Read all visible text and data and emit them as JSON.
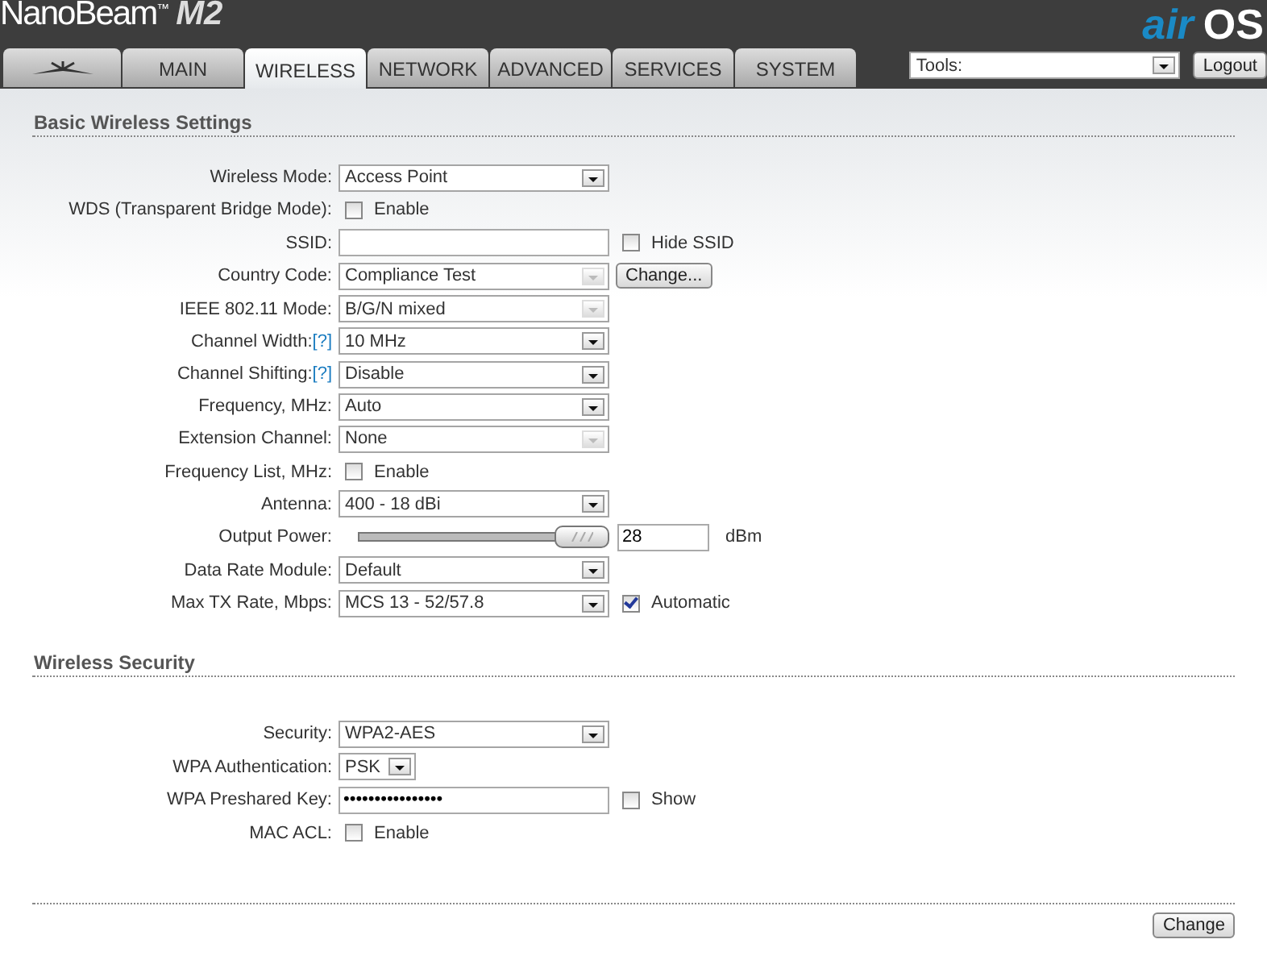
{
  "header": {
    "product": "NanoBeam",
    "trademark": "™",
    "model": "M2",
    "brand_prefix": "air",
    "brand_suffix": "OS"
  },
  "tabs": [
    {
      "kind": "icon",
      "selected": false
    },
    {
      "kind": "text",
      "label": "MAIN",
      "selected": false
    },
    {
      "kind": "text",
      "label": "WIRELESS",
      "selected": true
    },
    {
      "kind": "text",
      "label": "NETWORK",
      "selected": false
    },
    {
      "kind": "text",
      "label": "ADVANCED",
      "selected": false
    },
    {
      "kind": "text",
      "label": "SERVICES",
      "selected": false
    },
    {
      "kind": "text",
      "label": "SYSTEM",
      "selected": false
    }
  ],
  "tools": {
    "value": "Tools:"
  },
  "logout": "Logout",
  "sections": [
    {
      "title": "Basic Wireless Settings",
      "rows": [
        {
          "label": "Wireless Mode:",
          "kind": "select",
          "value": "Access Point",
          "disabled": false
        },
        {
          "label": "WDS (Transparent Bridge Mode):",
          "kind": "checkbox",
          "text": "Enable",
          "checked": false
        },
        {
          "label": "SSID:",
          "kind": "text",
          "checkbox": {
            "text": "Hide SSID",
            "checked": false
          }
        },
        {
          "label": "Country Code:",
          "kind": "select",
          "value": "Compliance Test",
          "disabled": true,
          "button": "Change..."
        },
        {
          "label": "IEEE 802.11 Mode:",
          "kind": "select",
          "value": "B/G/N mixed",
          "disabled": true
        },
        {
          "label": "Channel Width:",
          "help": "[?]",
          "kind": "select",
          "value": "10 MHz",
          "disabled": false
        },
        {
          "label": "Channel Shifting:",
          "help": "[?]",
          "kind": "select",
          "value": "Disable",
          "disabled": false
        },
        {
          "label": "Frequency, MHz:",
          "kind": "select",
          "value": "Auto",
          "disabled": false
        },
        {
          "label": "Extension Channel:",
          "kind": "select",
          "value": "None",
          "disabled": true
        },
        {
          "label": "Frequency List, MHz:",
          "kind": "checkbox",
          "text": "Enable",
          "checked": false
        },
        {
          "label": "Antenna:",
          "kind": "select",
          "value": "400 - 18 dBi",
          "disabled": false
        },
        {
          "label": "Output Power:",
          "kind": "slider",
          "level": 1.0,
          "value": "28",
          "unit": "dBm"
        },
        {
          "label": "Data Rate Module:",
          "kind": "select",
          "value": "Default",
          "disabled": false
        },
        {
          "label": "Max TX Rate, Mbps:",
          "kind": "select",
          "value": "MCS 13 - 52/57.8",
          "disabled": false,
          "checkbox": {
            "text": "Automatic",
            "checked": true
          }
        }
      ]
    },
    {
      "title": "Wireless Security",
      "rows": [
        {
          "label": "Security:",
          "kind": "select",
          "value": "WPA2-AES",
          "disabled": false
        },
        {
          "label": "WPA Authentication:",
          "kind": "small_select",
          "value": "PSK",
          "disabled": false
        },
        {
          "label": "WPA Preshared Key:",
          "kind": "text",
          "value": "••••••••••••••••",
          "checkbox": {
            "text": "Show",
            "checked": false
          }
        },
        {
          "label": "MAC ACL:",
          "kind": "checkbox",
          "text": "Enable",
          "checked": false
        }
      ]
    }
  ],
  "change_button": "Change"
}
